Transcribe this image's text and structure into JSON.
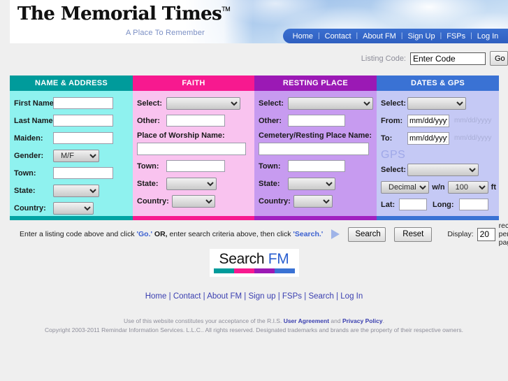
{
  "banner": {
    "logo": "The Memorial Times",
    "logo_tm": "TM",
    "tagline": "A Place To Remember",
    "nav": [
      {
        "label": "Home"
      },
      {
        "label": "Contact"
      },
      {
        "label": "About FM"
      },
      {
        "label": "Sign Up"
      },
      {
        "label": "FSPs"
      },
      {
        "label": "Log In"
      }
    ],
    "nav_separator": "|"
  },
  "listing_code": {
    "label": "Listing Code:",
    "value": "Enter Code",
    "placeholder": "Enter Code",
    "go_label": "Go"
  },
  "columns": {
    "name_address": {
      "header": "NAME & ADDRESS",
      "color": "#009b9b",
      "fields": {
        "first_name": {
          "label": "First Name:",
          "value": ""
        },
        "last_name": {
          "label": "Last Name:",
          "value": ""
        },
        "maiden": {
          "label": "Maiden:",
          "value": ""
        },
        "gender": {
          "label": "Gender:",
          "value": "M/F"
        },
        "town": {
          "label": "Town:",
          "value": ""
        },
        "state": {
          "label": "State:",
          "value": ""
        },
        "country": {
          "label": "Country:",
          "value": ""
        }
      }
    },
    "faith": {
      "header": "FAITH",
      "color": "#f7198f",
      "fields": {
        "select": {
          "label": "Select:",
          "value": ""
        },
        "other": {
          "label": "Other:",
          "value": ""
        },
        "place_name": {
          "label": "Place of Worship Name:",
          "value": ""
        },
        "town": {
          "label": "Town:",
          "value": ""
        },
        "state": {
          "label": "State:",
          "value": ""
        },
        "country": {
          "label": "Country:",
          "value": ""
        }
      }
    },
    "resting_place": {
      "header": "RESTING PLACE",
      "color": "#9b19b5",
      "fields": {
        "select": {
          "label": "Select:",
          "value": ""
        },
        "other": {
          "label": "Other:",
          "value": ""
        },
        "cemetery_name": {
          "label": "Cemetery/Resting Place Name:",
          "value": ""
        },
        "town": {
          "label": "Town:",
          "value": ""
        },
        "state": {
          "label": "State:",
          "value": ""
        },
        "country": {
          "label": "Country:",
          "value": ""
        }
      }
    },
    "dates_gps": {
      "header": "DATES & GPS",
      "color": "#3a72d4",
      "fields": {
        "select": {
          "label": "Select:",
          "value": ""
        },
        "from": {
          "label": "From:",
          "value": "mm/dd/yyyy",
          "hint": "mm/dd/yyyy"
        },
        "to": {
          "label": "To:",
          "value": "mm/dd/yyyy",
          "hint": "mm/dd/yyyy"
        },
        "gps_title": "GPS",
        "gps_select": {
          "label": "Select:",
          "value": ""
        },
        "format": {
          "value": "Decimal"
        },
        "within_label": "w/n",
        "radius": {
          "value": "100"
        },
        "radius_unit": "ft",
        "lat": {
          "label": "Lat:",
          "value": ""
        },
        "long": {
          "label": "Long:",
          "value": ""
        }
      }
    }
  },
  "actionbar": {
    "hint_1": "Enter a listing code above and click ",
    "hint_go": "'Go.'",
    "hint_or": " OR,",
    "hint_2": " enter search criteria above, then click ",
    "hint_search": "'Search.'",
    "search_label": "Search",
    "reset_label": "Reset",
    "display_label": "Display:",
    "display_value": "20",
    "records_label": "records per page"
  },
  "footer": {
    "logo_part1": "Search ",
    "logo_part2": "FM",
    "bar_colors": [
      "#009b9b",
      "#f7198f",
      "#9b19b5",
      "#3a72d4"
    ],
    "links": [
      {
        "label": "Home"
      },
      {
        "label": "Contact"
      },
      {
        "label": "About FM"
      },
      {
        "label": "Sign up"
      },
      {
        "label": "FSPs"
      },
      {
        "label": "Search"
      },
      {
        "label": "Log In"
      }
    ],
    "link_separator": "|",
    "legal_line1_a": "Use of this website constitutes your acceptance of the R.I.S. ",
    "legal_user_agreement": "User Agreement",
    "legal_line1_b": " and ",
    "legal_privacy": "Privacy Policy",
    "legal_line1_c": ".",
    "legal_line2": "Copyright 2003-2011 Remindar Information Services. L.L.C.. All rights reserved. Designated trademarks and brands are the property of their respective owners."
  }
}
